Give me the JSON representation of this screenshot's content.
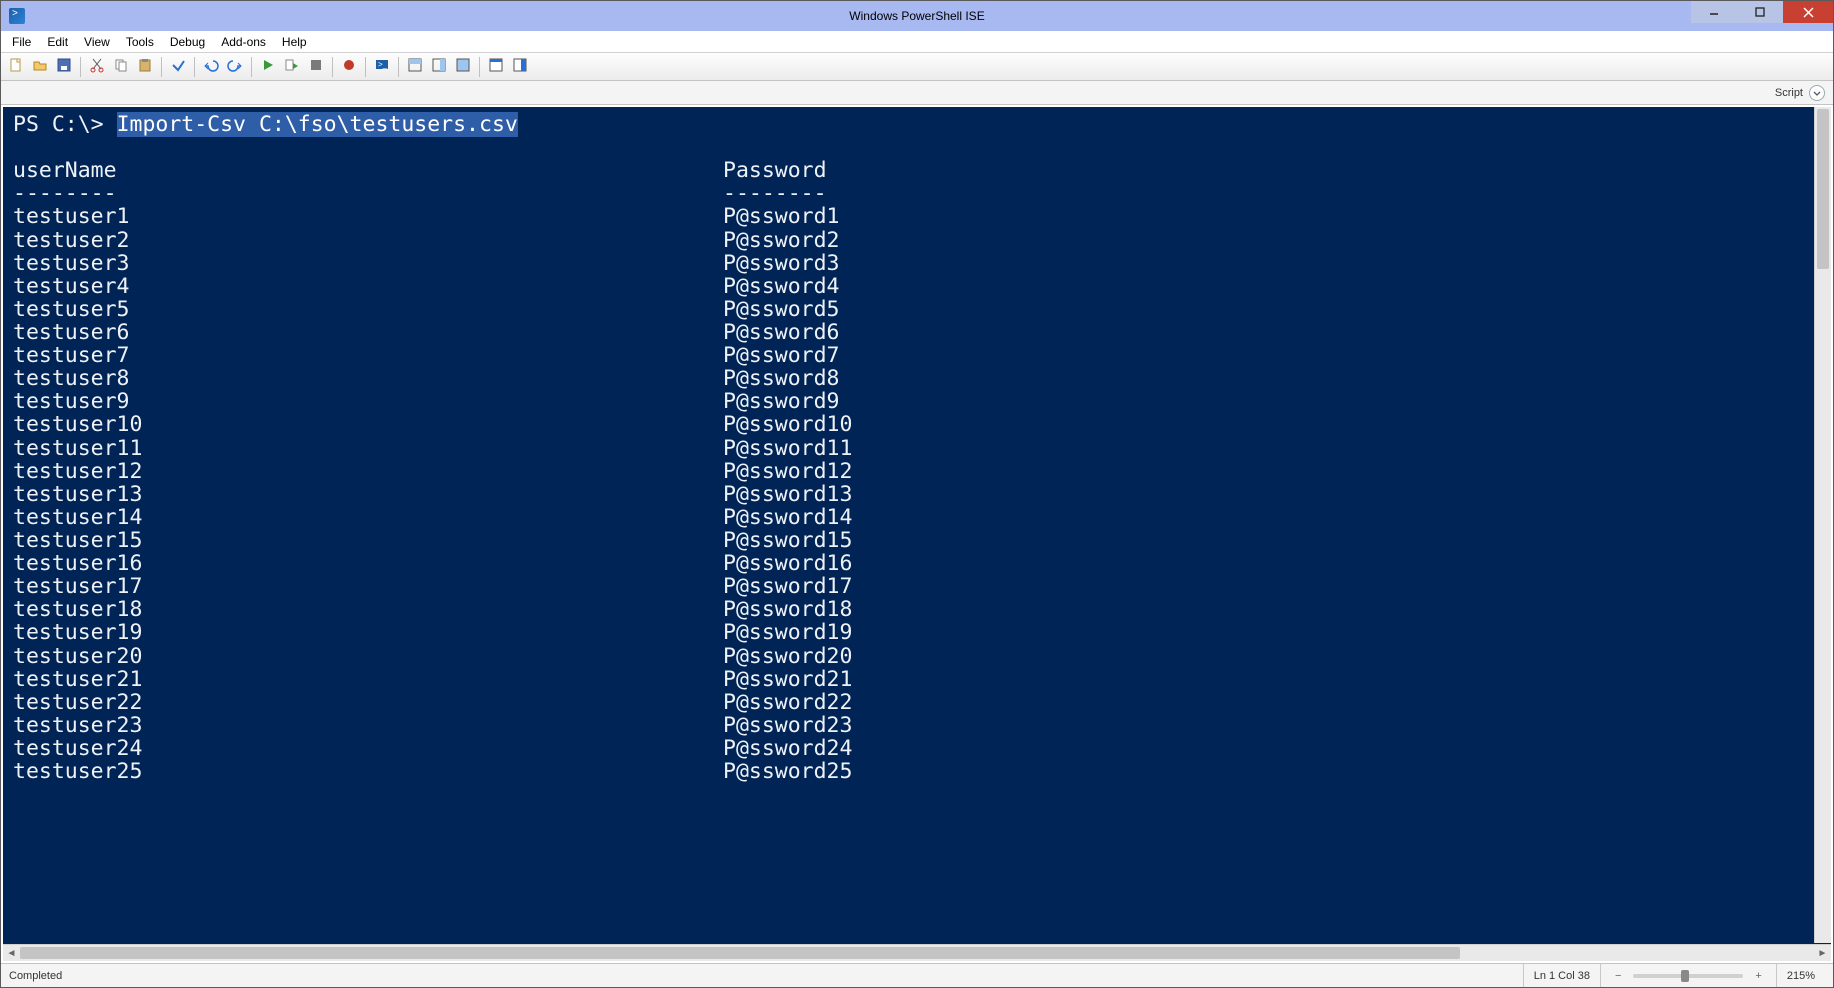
{
  "window": {
    "title": "Windows PowerShell ISE"
  },
  "menu": {
    "items": [
      "File",
      "Edit",
      "View",
      "Tools",
      "Debug",
      "Add-ons",
      "Help"
    ]
  },
  "tabstrip": {
    "label": "Script"
  },
  "console": {
    "prompt": "PS C:\\> ",
    "command": "Import-Csv C:\\fso\\testusers.csv",
    "columns": [
      "userName",
      "Password"
    ],
    "separator": "--------",
    "rows": [
      {
        "userName": "testuser1",
        "Password": "P@ssword1"
      },
      {
        "userName": "testuser2",
        "Password": "P@ssword2"
      },
      {
        "userName": "testuser3",
        "Password": "P@ssword3"
      },
      {
        "userName": "testuser4",
        "Password": "P@ssword4"
      },
      {
        "userName": "testuser5",
        "Password": "P@ssword5"
      },
      {
        "userName": "testuser6",
        "Password": "P@ssword6"
      },
      {
        "userName": "testuser7",
        "Password": "P@ssword7"
      },
      {
        "userName": "testuser8",
        "Password": "P@ssword8"
      },
      {
        "userName": "testuser9",
        "Password": "P@ssword9"
      },
      {
        "userName": "testuser10",
        "Password": "P@ssword10"
      },
      {
        "userName": "testuser11",
        "Password": "P@ssword11"
      },
      {
        "userName": "testuser12",
        "Password": "P@ssword12"
      },
      {
        "userName": "testuser13",
        "Password": "P@ssword13"
      },
      {
        "userName": "testuser14",
        "Password": "P@ssword14"
      },
      {
        "userName": "testuser15",
        "Password": "P@ssword15"
      },
      {
        "userName": "testuser16",
        "Password": "P@ssword16"
      },
      {
        "userName": "testuser17",
        "Password": "P@ssword17"
      },
      {
        "userName": "testuser18",
        "Password": "P@ssword18"
      },
      {
        "userName": "testuser19",
        "Password": "P@ssword19"
      },
      {
        "userName": "testuser20",
        "Password": "P@ssword20"
      },
      {
        "userName": "testuser21",
        "Password": "P@ssword21"
      },
      {
        "userName": "testuser22",
        "Password": "P@ssword22"
      },
      {
        "userName": "testuser23",
        "Password": "P@ssword23"
      },
      {
        "userName": "testuser24",
        "Password": "P@ssword24"
      },
      {
        "userName": "testuser25",
        "Password": "P@ssword25"
      }
    ]
  },
  "status": {
    "state": "Completed",
    "position": "Ln 1  Col 38",
    "zoom": "215%"
  },
  "toolbar_icons": [
    "new-file",
    "open-file",
    "save-file",
    "sep",
    "cut",
    "copy",
    "paste",
    "sep",
    "clear",
    "sep",
    "undo",
    "redo",
    "sep",
    "run-script",
    "run-selection",
    "stop",
    "sep",
    "breakpoint",
    "sep",
    "remote-powershell",
    "sep",
    "show-script-top",
    "show-script-right",
    "show-script-max",
    "sep",
    "show-command",
    "command-addon"
  ]
}
